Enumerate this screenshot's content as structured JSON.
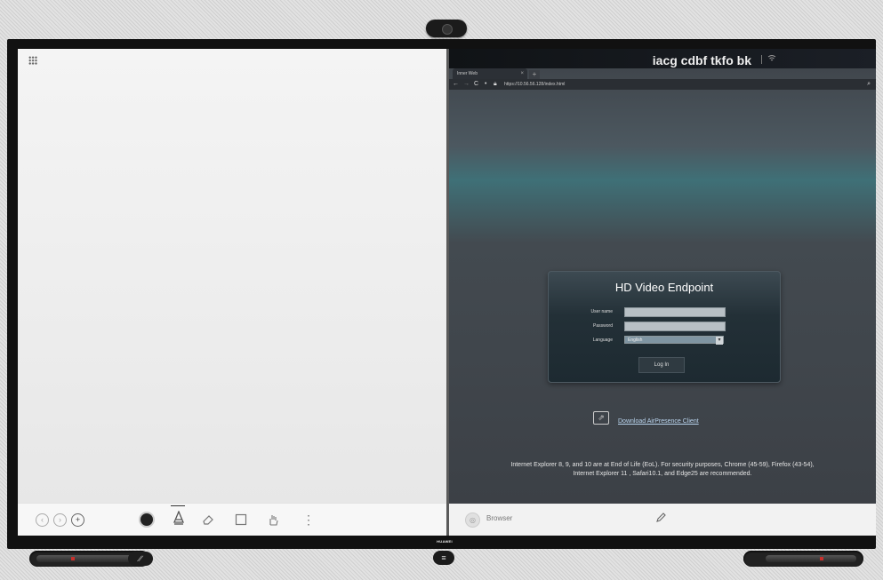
{
  "device": {
    "name": "iacg cdbf tkfo bk",
    "brand": "HUAWEI"
  },
  "whiteboard": {
    "toolbar": {
      "undo_icon": "‹",
      "redo_icon": "›",
      "add_icon": "+",
      "more_icon": "⋮"
    }
  },
  "browser": {
    "tab_title": "Inner Web",
    "url": "https://10.56.56.128/index.html",
    "login": {
      "title": "HD Video Endpoint",
      "username_label": "User name",
      "password_label": "Password",
      "language_label": "Language",
      "language_value": "English",
      "login_button": "Log In"
    },
    "download_link": "Download AirPresence Client",
    "notice_line1": "Internet Explorer 8, 9, and 10 are at End of Life (EoL). For security purposes, Chrome (45-59), Firefox (43-54),",
    "notice_line2": "Internet Explorer 11 , Safari10.1, and Edge25 are recommended.",
    "bottom_label": "Browser"
  },
  "colors": {
    "accent_red": "#c8302c",
    "link": "#b9d4ee"
  }
}
